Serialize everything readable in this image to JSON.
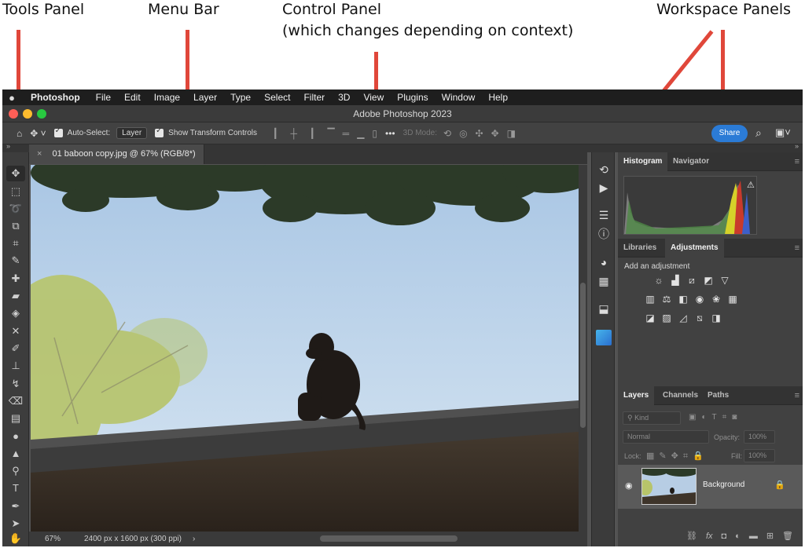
{
  "annotations": {
    "tools": "Tools Panel",
    "menubar": "Menu Bar",
    "control_line1": "Control Panel",
    "control_line2": "(which changes depending on context)",
    "workspace": "Workspace Panels"
  },
  "menu": {
    "app": "Photoshop",
    "items": [
      "File",
      "Edit",
      "Image",
      "Layer",
      "Type",
      "Select",
      "Filter",
      "3D",
      "View",
      "Plugins",
      "Window",
      "Help"
    ]
  },
  "window": {
    "title": "Adobe Photoshop 2023"
  },
  "options_bar": {
    "auto_select_label": "Auto-Select:",
    "auto_select_value": "Layer",
    "show_transform_label": "Show Transform Controls",
    "more": "•••",
    "mode_3d": "3D Mode:",
    "share": "Share"
  },
  "document": {
    "tab_title": "01 baboon copy.jpg @ 67% (RGB/8*)",
    "close": "×",
    "zoom": "67%",
    "size": "2400 px x 1600 px (300 ppi)",
    "nav_arrow": "›"
  },
  "panels": {
    "histogram_tab": "Histogram",
    "navigator_tab": "Navigator",
    "libraries_tab": "Libraries",
    "adjustments_tab": "Adjustments",
    "add_adjustment": "Add an adjustment",
    "layers_tab": "Layers",
    "channels_tab": "Channels",
    "paths_tab": "Paths",
    "kind": "Kind",
    "blend_mode": "Normal",
    "opacity_label": "Opacity:",
    "opacity_value": "100%",
    "lock_label": "Lock:",
    "fill_label": "Fill:",
    "fill_value": "100%",
    "layer_name": "Background",
    "footer_fx": "fx"
  },
  "colors": {
    "accent": "#2b7bd6",
    "arrow": "#e0473a",
    "panel_bg": "#414141"
  }
}
